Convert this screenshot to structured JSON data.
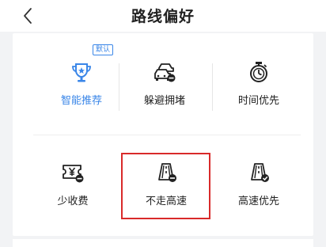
{
  "header": {
    "title": "路线偏好"
  },
  "badge": {
    "default_label": "默认"
  },
  "options": [
    {
      "label": "智能推荐",
      "icon": "trophy-star-icon",
      "selected": true
    },
    {
      "label": "躲避拥堵",
      "icon": "car-jam-minus-icon",
      "selected": false
    },
    {
      "label": "时间优先",
      "icon": "stopwatch-icon",
      "selected": false
    },
    {
      "label": "少收费",
      "icon": "yen-ticket-minus-icon",
      "selected": false
    },
    {
      "label": "不走高速",
      "icon": "highway-minus-icon",
      "selected": false
    },
    {
      "label": "高速优先",
      "icon": "highway-check-icon",
      "selected": false
    }
  ],
  "colors": {
    "accent": "#3a86e8",
    "highlight_border": "#d92a2a",
    "text": "#222222"
  }
}
